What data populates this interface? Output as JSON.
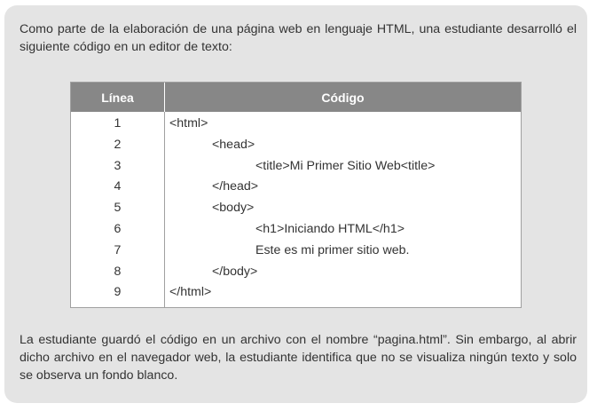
{
  "intro_text": "Como parte de la elaboración de una página web en lenguaje HTML, una estudiante desarrolló el siguiente código en un editor de texto:",
  "table": {
    "header_line": "Línea",
    "header_code": "Código",
    "rows": [
      {
        "num": "1",
        "code": "<html>"
      },
      {
        "num": "2",
        "code": "<head>"
      },
      {
        "num": "3",
        "code": "<title>Mi Primer Sitio Web<title>"
      },
      {
        "num": "4",
        "code": "</head>"
      },
      {
        "num": "5",
        "code": "<body>"
      },
      {
        "num": "6",
        "code": "<h1>Iniciando HTML</h1>"
      },
      {
        "num": "7",
        "code": "Este es mi primer sitio web."
      },
      {
        "num": "8",
        "code": "</body>"
      },
      {
        "num": "9",
        "code": "</html>"
      }
    ]
  },
  "outro_text": "La estudiante guardó el código en un archivo con el nombre “pagina.html”. Sin embargo, al abrir dicho archivo en el navegador web, la estudiante identifica que no se visualiza ningún texto y solo se observa un fondo blanco."
}
